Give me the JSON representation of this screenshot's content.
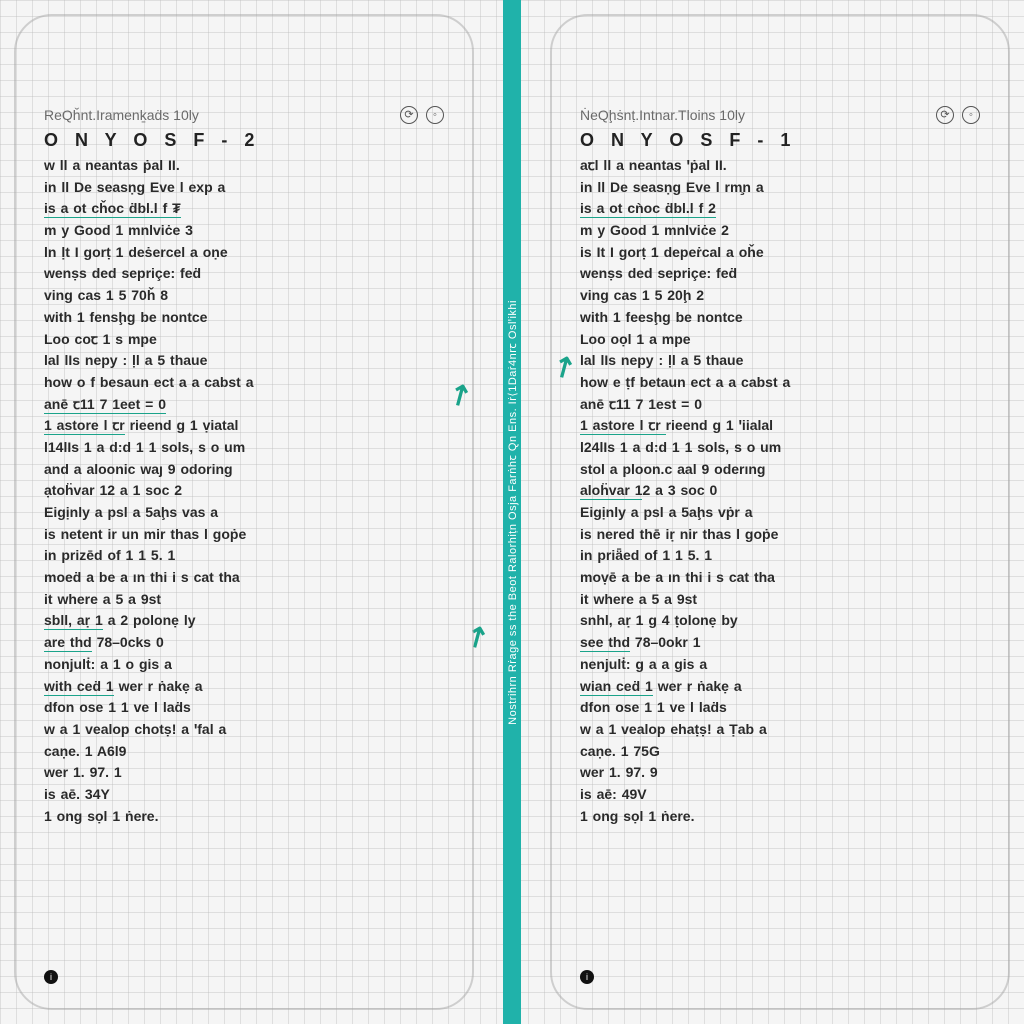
{
  "left_panel": {
    "header": "ReQȟnt.Iramenḵaḋs 10ly",
    "title": "O N Y O S F - 2",
    "lines": [
      "w ll a neantas ṗal II.",
      "in ll De seasṇg Eve l exp a",
      "is a ot cȟoc ḋbl.l f ₮",
      "m y Good 1 mnlviċe 3",
      "ln ḷt I gorṭ 1 deṡercel a oṇe",
      "wenṣs ded sepriçe: feḋ",
      "ving cas 1 5 70ȟ 8",
      "with 1 fensḩg be nontce",
      "Loo coꞇ 1 s mpe",
      "lal lIs nepy : ḷl a 5 thaue",
      "how o f besaun ect a a cabst a",
      "anē ꞇ11 7 1eet = 0",
      "1 astore l ꞇr rieend g 1 ṿiatal",
      "l14lIs 1 a d:d 1 1 sols, s o um",
      "and a aloonic waȷ 9 odoring",
      "ạtoḧvar 12 a 1 soc 2",
      "Eigịnly a psl a 5aḩs vas a",
      "is netent ir un mir thas l goṗe",
      "in prizēd of 1 1 5. 1",
      "moeḋ a be a ın thi i s cat tha",
      "it where a 5 a 9st",
      "sbll, aṛ 1 a 2 polonẹ ly",
      "are thd 78–0cks 0",
      "nonjulṫ: a 1 o gis a",
      "with ceḋ 1 wer r ṅakẹ a",
      "dfon ose 1 1 ve l laḋs",
      "w a 1 vealop chotṣ! a ꞌfal a",
      "caṇe. 1 A6l9",
      "wer 1. 97. 1",
      "is aē. 34Y",
      "1 ong sọl 1 ṅere."
    ]
  },
  "right_panel": {
    "header": "ṄeQḩṡnṭ.Intnar.Tloins 10ly",
    "title": "O N Y O S F - 1",
    "lines": [
      "aꞇl ll a neantas ꞌṗal II.",
      "in ll De seasṇg Eve l rm̧n a",
      "is a ot cǹoc ḋbl.l f 2",
      "m y Good 1 mnlviċe 2",
      "is It I gorṭ 1 depeṙcal a oȟe",
      "wenṣs ded sepriçe: feḋ",
      "ving cas 1 5 20ḩ 2",
      "with 1 feesḩg be nontce",
      "Loo oọl 1 a mpe",
      "lal lIs nepy : ḷl a 5 thaue",
      "how e ṭf betaun ect a a cabst a",
      "anē ꞇ11 7 1est = 0",
      "1 astore l ꞇr rieend g 1 ꞌiialal",
      "l24lIs 1 a d:d 1 1 sols, s o um",
      "stol a ploon.c aal 9 oderıng",
      "aloḧvar 12 a 3 soc 0",
      "Eigịnly a psl a 5aḩs vṗr a",
      "is nered thē iṛ nir thas l goṗe",
      "in priǟed of 1 1 5. 1",
      "moṿē a be a ın thi i s cat tha",
      "it where a 5 a 9st",
      "snhl, aṛ 1 g 4 ṭolonẹ by",
      "see thd 78–0okr 1",
      "nenjulṫ: g a a gis a",
      "wian ceḋ 1 wer r ṅakẹ a",
      "dfon ose 1 1 ve l laḋs",
      "w a 1 vealop ehaṭṣ! a Ṭab a",
      "caṇe. 1 75G",
      "wer 1. 97. 9",
      "is aē: 49V",
      "1 ong sọl 1 ṅere."
    ]
  },
  "underlines": {
    "left": {
      "2": "all",
      "11": "all",
      "12": "left",
      "21": "left",
      "22": "left",
      "24": "left"
    },
    "right": {
      "2": "all",
      "12": "left",
      "22": "left",
      "24": "left",
      "15": "left"
    }
  },
  "divider_label": "Nostrihrn Rṙage ss the Beot Ralorhiṭn Osja Farṅhꞇ Qn Ens. Iṙ⟨1Daṙ4nrꞇ Oslꞌikhi"
}
